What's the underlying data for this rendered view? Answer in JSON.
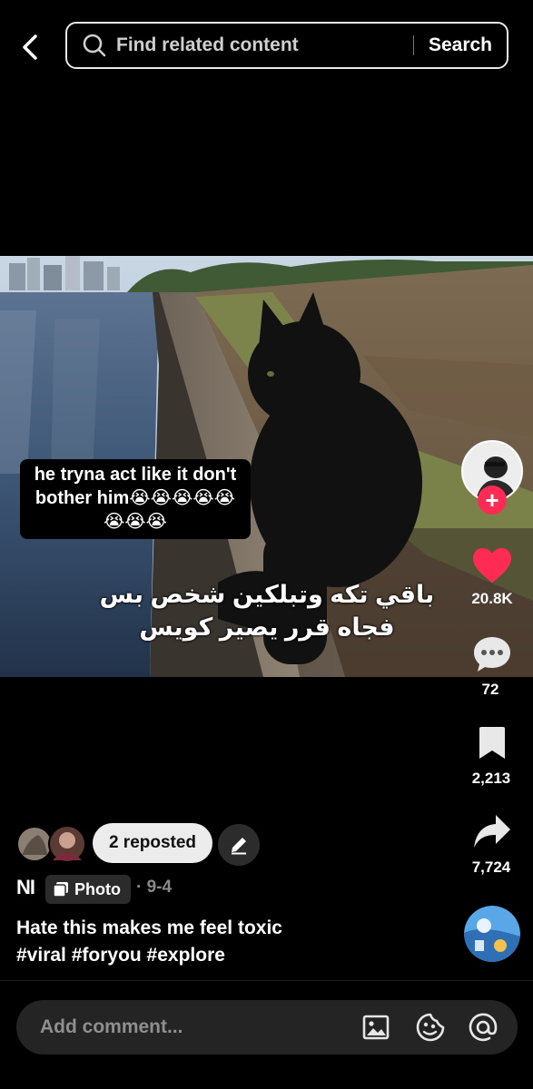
{
  "header": {
    "search_placeholder": "Find related content",
    "search_button": "Search"
  },
  "post": {
    "caption_overlay": "he tryna act like it don't bother him😭😭😭😭😭😭😭😭",
    "arabic_overlay_line1": "باقي تكه وتبلكين شخص بس",
    "arabic_overlay_line2": "فجاه قرر يصير كويس",
    "likes": "20.8K",
    "comments": "72",
    "saves": "2,213",
    "shares": "7,724",
    "reposted_label": "2 reposted",
    "author_initials": "NI",
    "type_label": "Photo",
    "date": "9-4",
    "description_line1": "Hate this makes me feel toxic",
    "description_line2": "#viral #foryou #explore"
  },
  "composer": {
    "placeholder": "Add comment..."
  },
  "icons": {
    "back": "chevron-left-icon",
    "search": "search-icon",
    "follow": "plus-icon",
    "like": "heart-icon",
    "comment": "speech-bubble-icon",
    "save": "bookmark-icon",
    "share": "share-arrow-icon",
    "edit": "pencil-icon",
    "photo": "photo-icon",
    "image": "image-icon",
    "emoji": "emoji-icon",
    "mention": "at-icon"
  },
  "colors": {
    "like_red": "#fe2c55",
    "background": "#000000"
  }
}
